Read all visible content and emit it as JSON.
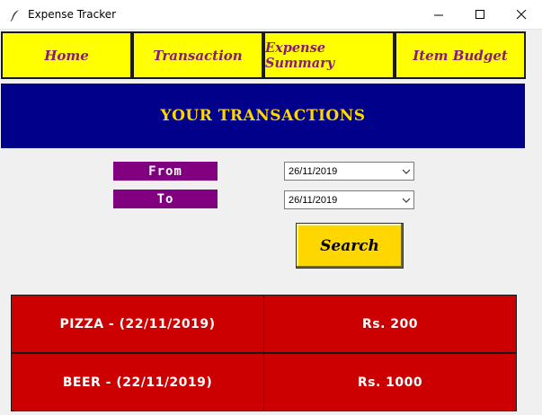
{
  "window": {
    "title": "Expense Tracker"
  },
  "nav": {
    "tabs": [
      {
        "label": "Home"
      },
      {
        "label": "Transaction"
      },
      {
        "label": "Expense Summary"
      },
      {
        "label": "Item Budget"
      }
    ]
  },
  "banner": {
    "title": "YOUR TRANSACTIONS"
  },
  "filter": {
    "from_label": "From",
    "to_label": "To",
    "from_date": "26/11/2019",
    "to_date": "26/11/2019",
    "search_label": "Search"
  },
  "transactions": [
    {
      "item": "PIZZA - (22/11/2019)",
      "amount": "Rs. 200"
    },
    {
      "item": "BEER - (22/11/2019)",
      "amount": "Rs. 1000"
    }
  ],
  "colors": {
    "nav_bg": "#ffff00",
    "nav_text": "#8b1a7a",
    "banner_bg": "#00008b",
    "banner_text": "#ffd700",
    "label_bg": "#800080",
    "search_bg": "#ffd700",
    "row_bg": "#cc0000"
  },
  "icons": {
    "app": "feather-icon",
    "minimize": "minimize-icon",
    "maximize": "maximize-icon",
    "close": "close-icon",
    "dropdown": "chevron-down-icon"
  }
}
